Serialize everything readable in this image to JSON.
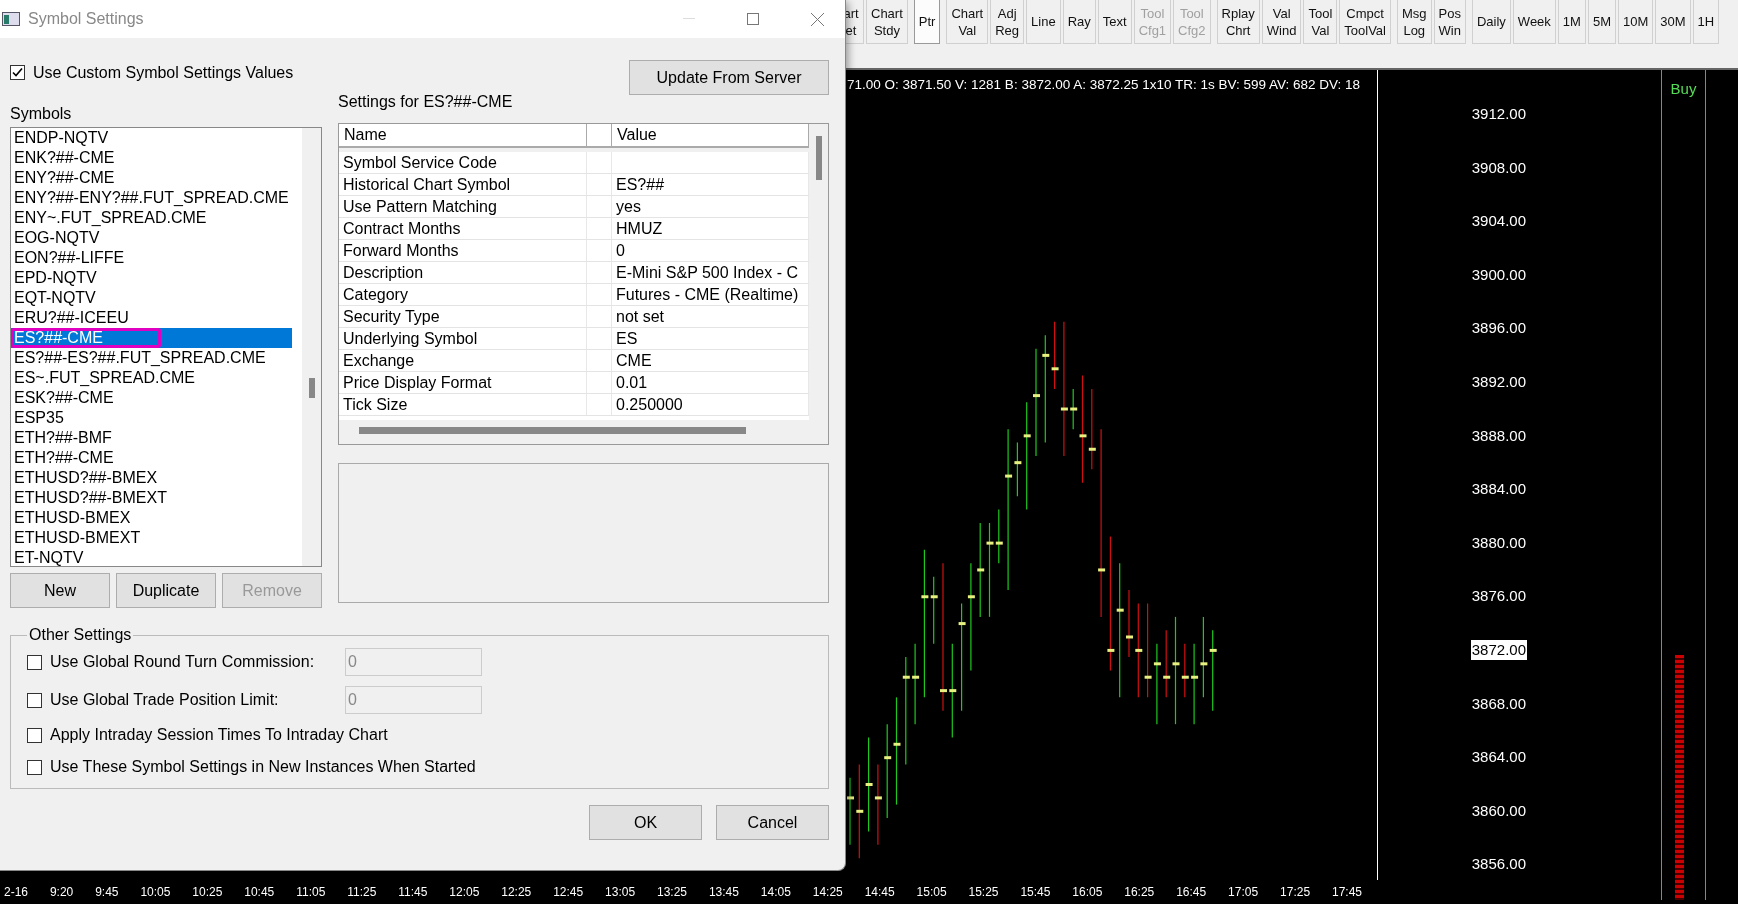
{
  "toolbar": {
    "groups": [
      [
        {
          "lines": [
            "art",
            "et"
          ],
          "disabled": false,
          "selected": false
        },
        {
          "lines": [
            "Chart",
            "Stdy"
          ],
          "disabled": false,
          "selected": false
        }
      ],
      [
        {
          "lines": [
            "Ptr"
          ],
          "disabled": false,
          "selected": true
        }
      ],
      [
        {
          "lines": [
            "Chart",
            "Val"
          ],
          "disabled": false,
          "selected": false
        },
        {
          "lines": [
            "Adj",
            "Reg"
          ],
          "disabled": false,
          "selected": false
        },
        {
          "lines": [
            "Line"
          ],
          "disabled": false,
          "selected": false
        },
        {
          "lines": [
            "Ray"
          ],
          "disabled": false,
          "selected": false
        },
        {
          "lines": [
            "Text"
          ],
          "disabled": false,
          "selected": false
        },
        {
          "lines": [
            "Tool",
            "Cfg1"
          ],
          "disabled": true,
          "selected": false
        },
        {
          "lines": [
            "Tool",
            "Cfg2"
          ],
          "disabled": true,
          "selected": false
        }
      ],
      [
        {
          "lines": [
            "Rplay",
            "Chrt"
          ],
          "disabled": false,
          "selected": false
        },
        {
          "lines": [
            "Val",
            "Wind"
          ],
          "disabled": false,
          "selected": false
        },
        {
          "lines": [
            "Tool",
            "Val"
          ],
          "disabled": false,
          "selected": false
        },
        {
          "lines": [
            "Cmpct",
            "ToolVal"
          ],
          "disabled": false,
          "selected": false
        }
      ],
      [
        {
          "lines": [
            "Msg",
            "Log"
          ],
          "disabled": false,
          "selected": false
        },
        {
          "lines": [
            "Pos",
            "Win"
          ],
          "disabled": false,
          "selected": false
        }
      ],
      [
        {
          "lines": [
            "Daily"
          ],
          "disabled": false,
          "selected": false
        },
        {
          "lines": [
            "Week"
          ],
          "disabled": false,
          "selected": false
        },
        {
          "lines": [
            "1M"
          ],
          "disabled": false,
          "selected": false
        },
        {
          "lines": [
            "5M"
          ],
          "disabled": false,
          "selected": false
        },
        {
          "lines": [
            "10M"
          ],
          "disabled": false,
          "selected": false
        },
        {
          "lines": [
            "30M"
          ],
          "disabled": false,
          "selected": false
        },
        {
          "lines": [
            "1H"
          ],
          "disabled": false,
          "selected": false
        }
      ]
    ]
  },
  "chart": {
    "info_line": "71.00 O: 3871.50 V: 1281 B: 3872.00 A: 3872.25 1x10 TR: 1s BV: 599 AV: 682 DV: 18",
    "price_labels": [
      {
        "text": "3912.00",
        "current": false
      },
      {
        "text": "3908.00",
        "current": false
      },
      {
        "text": "3904.00",
        "current": false
      },
      {
        "text": "3900.00",
        "current": false
      },
      {
        "text": "3896.00",
        "current": false
      },
      {
        "text": "3892.00",
        "current": false
      },
      {
        "text": "3888.00",
        "current": false
      },
      {
        "text": "3884.00",
        "current": false
      },
      {
        "text": "3880.00",
        "current": false
      },
      {
        "text": "3876.00",
        "current": false
      },
      {
        "text": "3872.00",
        "current": true
      },
      {
        "text": "3868.00",
        "current": false
      },
      {
        "text": "3864.00",
        "current": false
      },
      {
        "text": "3860.00",
        "current": false
      },
      {
        "text": "3856.00",
        "current": false
      }
    ],
    "time_labels": [
      "2-16",
      "9:20",
      "9:45",
      "10:05",
      "10:25",
      "10:45",
      "11:05",
      "11:25",
      "11:45",
      "12:05",
      "12:25",
      "12:45",
      "13:05",
      "13:25",
      "13:45",
      "14:05",
      "14:25",
      "14:45",
      "15:05",
      "15:25",
      "15:45",
      "16:05",
      "16:25",
      "16:45",
      "17:05",
      "17:25",
      "17:45"
    ],
    "buy_label": "Buy"
  },
  "dialog": {
    "title": "Symbol Settings",
    "use_custom": {
      "label": "Use Custom Symbol Settings Values",
      "checked": true
    },
    "update_button": "Update From Server",
    "symbols_label": "Symbols",
    "symbols": [
      {
        "text": "ENDP-NQTV",
        "selected": false
      },
      {
        "text": "ENK?##-CME",
        "selected": false
      },
      {
        "text": "ENY?##-CME",
        "selected": false
      },
      {
        "text": "ENY?##-ENY?##.FUT_SPREAD.CME",
        "selected": false
      },
      {
        "text": "ENY~.FUT_SPREAD.CME",
        "selected": false
      },
      {
        "text": "EOG-NQTV",
        "selected": false
      },
      {
        "text": "EON?##-LIFFE",
        "selected": false
      },
      {
        "text": "EPD-NQTV",
        "selected": false
      },
      {
        "text": "EQT-NQTV",
        "selected": false
      },
      {
        "text": "ERU?##-ICEEU",
        "selected": false
      },
      {
        "text": "ES?##-CME",
        "selected": true
      },
      {
        "text": "ES?##-ES?##.FUT_SPREAD.CME",
        "selected": false
      },
      {
        "text": "ES~.FUT_SPREAD.CME",
        "selected": false
      },
      {
        "text": "ESK?##-CME",
        "selected": false
      },
      {
        "text": "ESP35",
        "selected": false
      },
      {
        "text": "ETH?##-BMF",
        "selected": false
      },
      {
        "text": "ETH?##-CME",
        "selected": false
      },
      {
        "text": "ETHUSD?##-BMEX",
        "selected": false
      },
      {
        "text": "ETHUSD?##-BMEXT",
        "selected": false
      },
      {
        "text": "ETHUSD-BMEX",
        "selected": false
      },
      {
        "text": "ETHUSD-BMEXT",
        "selected": false
      },
      {
        "text": "ET-NQTV",
        "selected": false
      }
    ],
    "list_buttons": [
      {
        "label": "New",
        "disabled": false
      },
      {
        "label": "Duplicate",
        "disabled": false
      },
      {
        "label": "Remove",
        "disabled": true
      }
    ],
    "settings_label": "Settings for ES?##-CME",
    "table": {
      "columns": [
        "Name",
        "Value"
      ],
      "rows": [
        [
          "Symbol Service Code",
          ""
        ],
        [
          "Historical Chart Symbol",
          "ES?##"
        ],
        [
          "Use Pattern Matching",
          "yes"
        ],
        [
          "Contract Months",
          "HMUZ"
        ],
        [
          "Forward Months",
          "0"
        ],
        [
          "Description",
          "E-Mini S&P 500 Index - C"
        ],
        [
          "Category",
          "Futures - CME (Realtime)"
        ],
        [
          "Security Type",
          "not set"
        ],
        [
          "Underlying Symbol",
          "ES"
        ],
        [
          "Exchange",
          "CME"
        ],
        [
          "Price Display Format",
          "0.01"
        ],
        [
          "Tick Size",
          "0.250000"
        ]
      ]
    },
    "other_settings": {
      "title": "Other Settings",
      "options": [
        {
          "kind": "field",
          "label": "Use Global Round Turn Commission:",
          "checked": false,
          "value": "0"
        },
        {
          "kind": "field",
          "label": "Use Global Trade Position Limit:",
          "checked": false,
          "value": "0"
        },
        {
          "kind": "plain",
          "label": "Apply Intraday Session Times To Intraday Chart",
          "checked": false
        },
        {
          "kind": "plain",
          "label": "Use These Symbol Settings in New Instances When Started",
          "checked": false
        }
      ]
    },
    "footer_buttons": [
      "OK",
      "Cancel"
    ]
  }
}
